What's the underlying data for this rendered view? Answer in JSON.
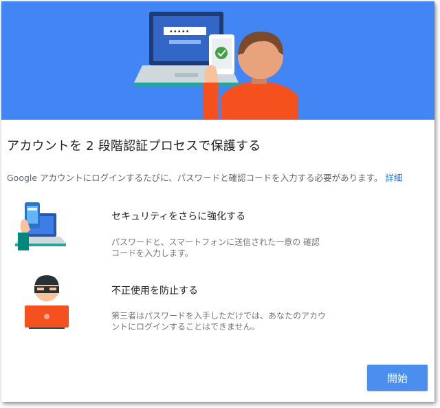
{
  "header": {
    "title": "アカウントを 2 段階認証プロセスで保護する",
    "description": "Google アカウントにログインするたびに、パスワードと確認コードを入力する必要があります。",
    "details_link": "詳細",
    "password_mask": "•••••"
  },
  "features": [
    {
      "title": "セキュリティをさらに強化する",
      "body_line1": "パスワードと、スマートフォンに送信された一意の 確認",
      "body_line2": "コードを入力します。",
      "icon": "phone-laptop-icon"
    },
    {
      "title": "不正使用を防止する",
      "body_line1": "第三者はパスワードを入手しただけでは、あなたのアカウ",
      "body_line2": "ントにログインすることはできません。",
      "icon": "hacker-icon"
    }
  ],
  "actions": {
    "start_label": "開始"
  },
  "colors": {
    "hero_bg": "#4285f4",
    "button_bg": "#4a8ef0",
    "link": "#1a73e8"
  }
}
